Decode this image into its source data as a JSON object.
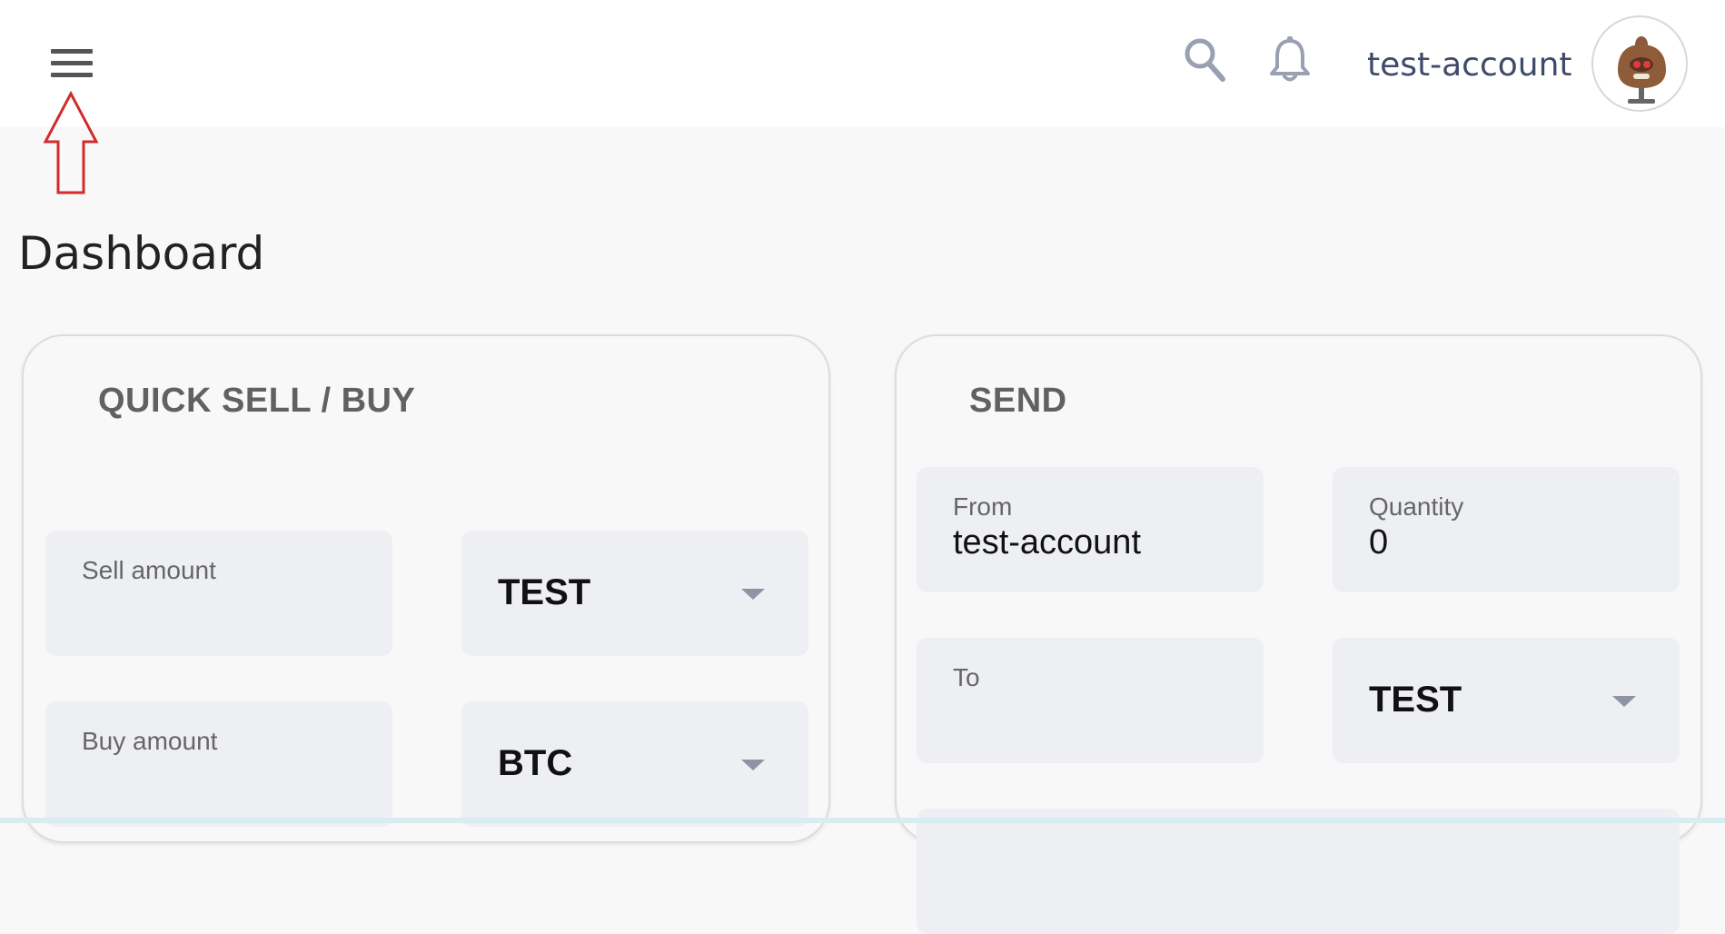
{
  "header": {
    "account_name": "test-account",
    "icons": {
      "menu": "menu-icon",
      "search": "search-icon",
      "notifications": "bell-icon",
      "avatar": "user-avatar"
    },
    "colors": {
      "icon_gray": "#9aa0b2",
      "account_text": "#3f4a6b",
      "annotation_red": "#d22b2b"
    }
  },
  "page": {
    "title": "Dashboard"
  },
  "quick_trade": {
    "title": "QUICK SELL / BUY",
    "sell_amount": {
      "label": "Sell amount",
      "value": ""
    },
    "sell_currency": {
      "value": "TEST"
    },
    "buy_amount": {
      "label": "Buy amount",
      "value": ""
    },
    "buy_currency": {
      "value": "BTC"
    }
  },
  "send": {
    "title": "SEND",
    "from": {
      "label": "From",
      "value": "test-account"
    },
    "quantity": {
      "label": "Quantity",
      "value": "0"
    },
    "to": {
      "label": "To",
      "value": ""
    },
    "currency": {
      "value": "TEST"
    }
  }
}
